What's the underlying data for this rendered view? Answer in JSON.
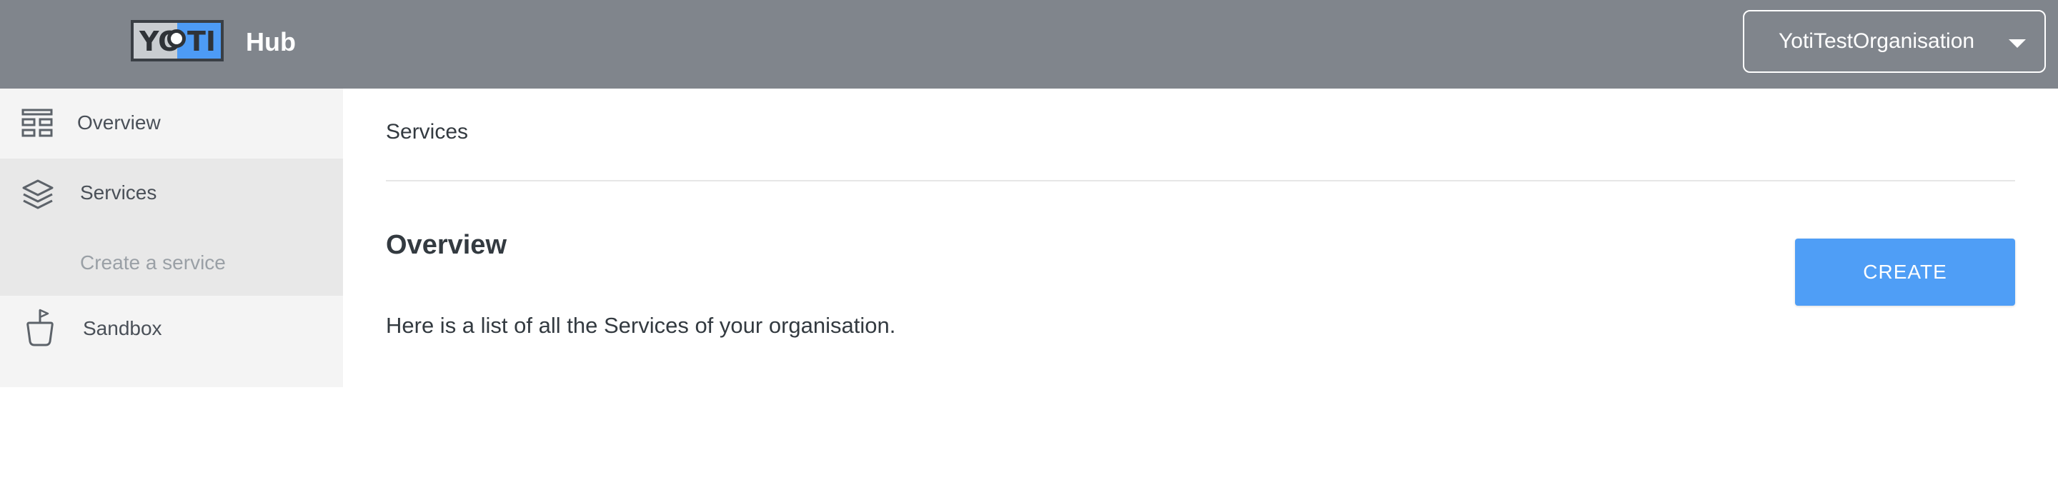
{
  "header": {
    "logo_text_left": "YO",
    "logo_text_right": "TI",
    "app_name": "Hub",
    "organisation": "YotiTestOrganisation"
  },
  "sidebar": {
    "items": [
      {
        "label": "Overview",
        "icon": "dashboard-icon"
      },
      {
        "label": "Services",
        "icon": "layers-icon",
        "sub_items": [
          {
            "label": "Create a service"
          }
        ]
      },
      {
        "label": "Sandbox",
        "icon": "sandbox-icon"
      }
    ]
  },
  "main": {
    "breadcrumb": "Services",
    "title": "Overview",
    "description": "Here is a list of all the Services of your organisation.",
    "create_label": "CREATE"
  },
  "colors": {
    "topbar": "#80858c",
    "accent": "#4f9ef6",
    "logo_blue": "#4d9bf5",
    "sidebar_bg": "#f4f4f4",
    "sidebar_active": "#e8e8e8"
  }
}
